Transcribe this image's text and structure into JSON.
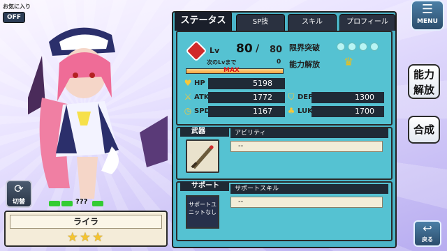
{
  "favorite": {
    "label": "お気に入り",
    "toggle": "OFF"
  },
  "switch_button": {
    "label": "切替"
  },
  "unknown_marker": "???",
  "character": {
    "name": "ライラ",
    "stars": "★★★"
  },
  "tabs": [
    "ステータス",
    "SP技",
    "スキル",
    "プロフィール"
  ],
  "status": {
    "lv_label": "Lv",
    "level": "80",
    "level_sep": "/",
    "level_max": "80",
    "next_lv_label": "次のLvまで",
    "next_lv_value": "0",
    "max_label": "MAX",
    "limit_break_label": "限界突破",
    "ability_unlock_label": "能力解放",
    "hp_label": "HP",
    "hp": "5198",
    "atk_label": "ATK",
    "atk": "1772",
    "def_label": "DEF",
    "def": "1300",
    "spd_label": "SPD",
    "spd": "1167",
    "luk_label": "LUK",
    "luk": "1700"
  },
  "weapon": {
    "header": "武器",
    "ability_label": "アビリティ",
    "ability_value": "--"
  },
  "support": {
    "header": "サポート",
    "skill_label": "サポートスキル",
    "skill_value": "--",
    "slot_text": "サポートユニットなし"
  },
  "right": {
    "menu": "MENU",
    "ability_button": "能力解放",
    "fuse_button": "合成",
    "back": "戻る"
  },
  "colors": {
    "panel": "#4bb4c8",
    "dark": "#1f2a36",
    "accent_red": "#d02a2a",
    "star": "#f4c430"
  }
}
